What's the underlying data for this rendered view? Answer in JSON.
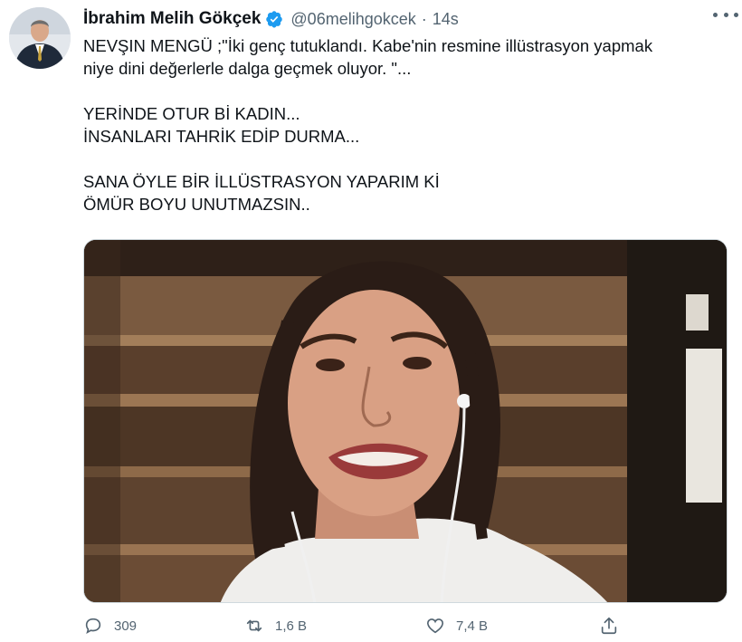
{
  "author": {
    "name": "İbrahim Melih Gökçek",
    "handle": "@06melihgokcek",
    "separator": "·",
    "time": "14s"
  },
  "tweet": {
    "lines_block1": [
      "NEVŞIN MENGÜ ;\"İki genç tutuklandı. Kabe'nin resmine illüstrasyon yapmak",
      "niye dini değerlerle dalga geçmek oluyor. \"..."
    ],
    "lines_block2": [
      "YERİNDE OTUR Bİ KADIN...",
      "İNSANLARI TAHRİK EDİP DURMA..."
    ],
    "lines_block3": [
      "SANA ÖYLE BİR İLLÜSTRASYON YAPARIM Kİ",
      "ÖMÜR BOYU UNUTMAZSIN.."
    ]
  },
  "actions": {
    "replies": "309",
    "retweets": "1,6 B",
    "likes": "7,4 B"
  },
  "icons": {
    "verified": "verified-badge-icon",
    "more": "more-icon",
    "reply": "reply-icon",
    "retweet": "retweet-icon",
    "like": "heart-icon",
    "share": "share-icon"
  },
  "colors": {
    "verified": "#1d9bf0",
    "muted": "#536471",
    "text": "#0f1419"
  }
}
